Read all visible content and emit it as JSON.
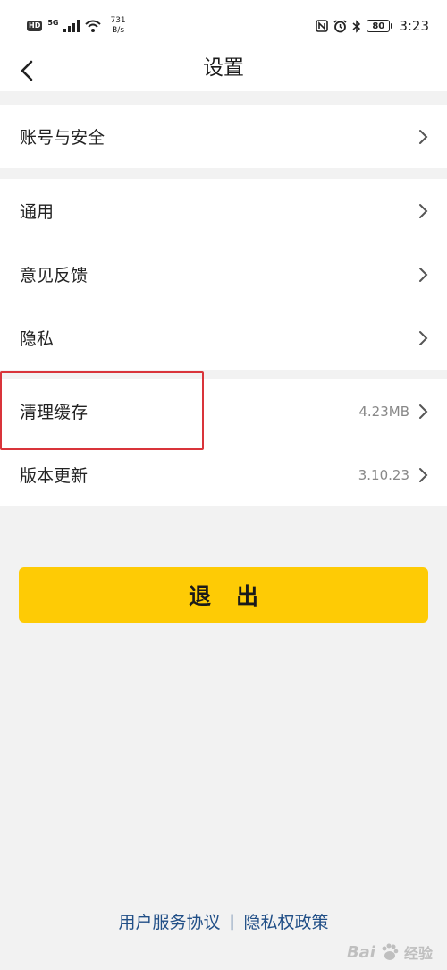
{
  "status_bar": {
    "hd": "HD",
    "signal": "5G",
    "net_speed_value": "731",
    "net_speed_unit": "B/s",
    "battery": "80",
    "time": "3:23"
  },
  "nav": {
    "title": "设置"
  },
  "groups": [
    {
      "items": [
        {
          "label": "账号与安全",
          "value": ""
        }
      ]
    },
    {
      "items": [
        {
          "label": "通用",
          "value": ""
        },
        {
          "label": "意见反馈",
          "value": ""
        },
        {
          "label": "隐私",
          "value": ""
        }
      ]
    },
    {
      "items": [
        {
          "label": "清理缓存",
          "value": "4.23MB"
        },
        {
          "label": "版本更新",
          "value": "3.10.23"
        }
      ]
    }
  ],
  "logout_label": "退出",
  "footer": {
    "terms": "用户服务协议",
    "separator": "|",
    "privacy_policy": "隐私权政策"
  },
  "watermark": {
    "brand": "Bai",
    "suffix": "经验"
  },
  "colors": {
    "accent_yellow": "#fecb05",
    "link_blue": "#214f87",
    "highlight_red": "#d9343a",
    "background": "#f2f2f2"
  }
}
